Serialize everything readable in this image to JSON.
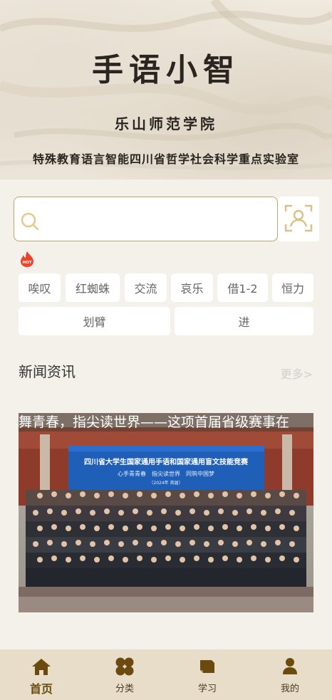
{
  "header": {
    "app_title": "手语小智",
    "school": "乐山师范学院",
    "lab": "特殊教育语言智能四川省哲学社会科学重点实验室"
  },
  "search": {
    "placeholder": "",
    "value": ""
  },
  "hot": {
    "badge": "HOT"
  },
  "tags": [
    "唉叹",
    "红蜘蛛",
    "交流",
    "哀乐",
    "借1-2",
    "恒力",
    "划臂",
    "进"
  ],
  "news": {
    "section_title": "新闻资讯",
    "more_label": "更多>",
    "headline": "舞青春，指尖读世界——这项首届省级赛事在",
    "banner_text": "四川省大学生国家通用手语和国家通用盲文技能竞赛",
    "banner_slogan": "心手青青春　指尖读世界　同筑中国梦",
    "banner_year": "（2024年 首届）"
  },
  "tabbar": {
    "items": [
      {
        "label": "首页",
        "icon": "home-icon",
        "active": true
      },
      {
        "label": "分类",
        "icon": "category-icon",
        "active": false
      },
      {
        "label": "学习",
        "icon": "study-icon",
        "active": false
      },
      {
        "label": "我的",
        "icon": "user-icon",
        "active": false
      }
    ]
  },
  "colors": {
    "accent": "#c4a46a",
    "tab_active": "#6b4a10",
    "tab_bg": "#e7ddc8",
    "hot": "#e8452c"
  }
}
